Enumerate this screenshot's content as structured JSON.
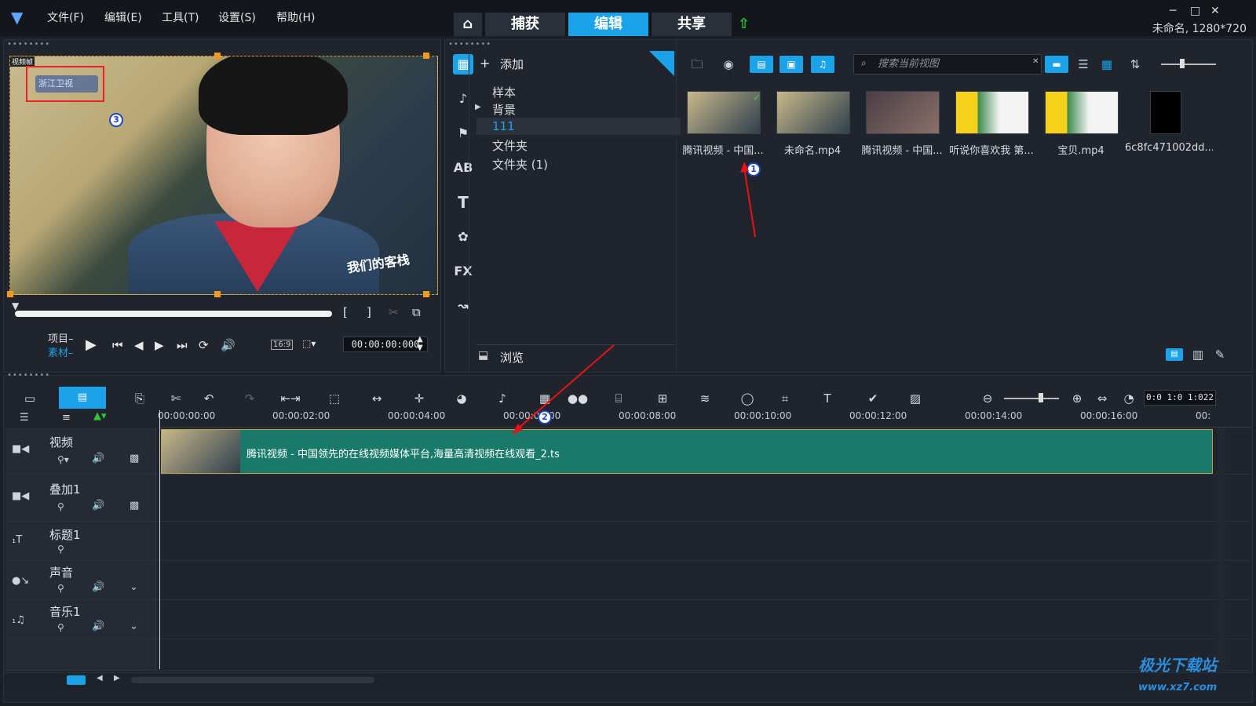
{
  "menu": [
    "文件(F)",
    "编辑(E)",
    "工具(T)",
    "设置(S)",
    "帮助(H)"
  ],
  "nav_tabs": [
    "捕获",
    "编辑",
    "共享"
  ],
  "project_info": "未命名, 1280*720",
  "preview": {
    "watermark": "浙江卫视",
    "labels": {
      "project": "项目–",
      "clip": "素材–"
    },
    "timecode": "00:00:00:000",
    "aspect": "16:9",
    "corner_tag": "视频帧"
  },
  "library": {
    "add_label": "添加",
    "tree": [
      "样本",
      "背景",
      "111",
      "文件夹",
      "文件夹 (1)"
    ],
    "selected_tree_index": 2,
    "browse_label": "浏览",
    "search_placeholder": "搜索当前视图",
    "thumbnails": [
      {
        "caption": "腾讯视频 - 中国..."
      },
      {
        "caption": "未命名.mp4"
      },
      {
        "caption": "腾讯视频 - 中国..."
      },
      {
        "caption": "听说你喜欢我 第..."
      },
      {
        "caption": "宝贝.mp4"
      },
      {
        "caption": "6c8fc471002dd..."
      }
    ]
  },
  "timeline": {
    "ruler": [
      "00:00:00:00",
      "00:00:02:00",
      "00:00:04:00",
      "00:00:06:00",
      "00:00:08:00",
      "00:00:10:00",
      "00:00:12:00",
      "00:00:14:00",
      "00:00:16:00",
      "00:"
    ],
    "zoom_timecode": "0:0 1:0 1:022",
    "tracks": [
      "视频",
      "叠加1",
      "标题1",
      "声音",
      "音乐1"
    ],
    "clip_title": "腾讯视频 - 中国领先的在线视频媒体平台,海量高清视频在线观看_2.ts"
  },
  "badges": [
    "1",
    "2",
    "3"
  ],
  "watermark_site": "极光下载站",
  "watermark_url": "www.xz7.com",
  "colors": {
    "accent": "#1aa3e8",
    "clip": "#197a6b",
    "annotation": "#e11111"
  }
}
